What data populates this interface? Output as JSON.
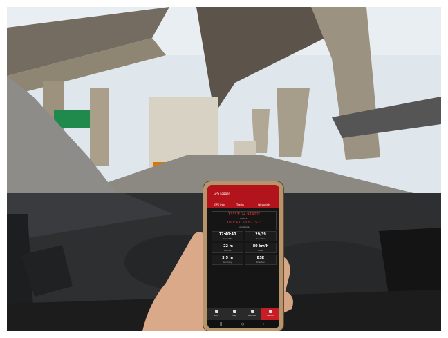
{
  "app": {
    "title": "GPS Logger",
    "tabs": [
      "GPS Info",
      "Tracks",
      "Waypoints"
    ],
    "latitude": "13°37' 24.97402\"",
    "latitude_label": "Latitude",
    "longitude": "100°43' 53.82752\"",
    "longitude_label": "Longitude",
    "stats": [
      {
        "value": "17:40:40",
        "label": "Time of Fix"
      },
      {
        "value": "29/39",
        "label": "Satellites"
      },
      {
        "value": "-22 m",
        "label": "Altitude"
      },
      {
        "value": "80 km/h",
        "label": "Speed"
      },
      {
        "value": "3.5 m",
        "label": "Accuracy"
      },
      {
        "value": "ESE",
        "label": "Direction"
      }
    ],
    "nav": [
      "Lock",
      "Map",
      "Annotate",
      "Record"
    ]
  },
  "colors": {
    "app_red": "#b3131a",
    "phone_case": "#b7946a",
    "sky": "#dfe8ee"
  }
}
